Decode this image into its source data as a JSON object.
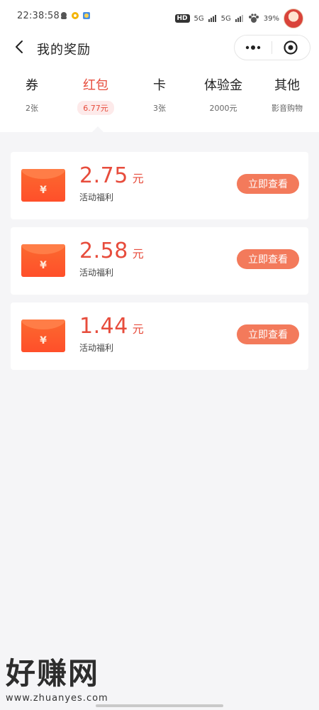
{
  "status_bar": {
    "time": "22:38:58",
    "hd": "HD",
    "signal_1": "5G",
    "signal_2": "5G",
    "battery": "39%"
  },
  "header": {
    "title": "我的奖励",
    "back_icon": "chevron-left-icon",
    "more_icon": "more-dots-icon",
    "close_icon": "target-close-icon"
  },
  "tabs": [
    {
      "label": "券",
      "sub": "2张"
    },
    {
      "label": "红包",
      "sub": "6.77元",
      "active": true
    },
    {
      "label": "卡",
      "sub": "3张"
    },
    {
      "label": "体验金",
      "sub": "2000元"
    },
    {
      "label": "其他",
      "sub": "影音购物"
    }
  ],
  "rewards": [
    {
      "amount": "2.75",
      "unit": "元",
      "desc": "活动福利",
      "button": "立即查看",
      "icon_text": "¥"
    },
    {
      "amount": "2.58",
      "unit": "元",
      "desc": "活动福利",
      "button": "立即查看",
      "icon_text": "¥"
    },
    {
      "amount": "1.44",
      "unit": "元",
      "desc": "活动福利",
      "button": "立即查看",
      "icon_text": "¥"
    }
  ],
  "watermark": {
    "big": "好赚网",
    "small": "www.zhuanyes.com"
  },
  "colors": {
    "accent": "#e74c3c",
    "button": "#f37a5b",
    "envelope": "#ff5a2c",
    "background": "#f5f5f7"
  }
}
